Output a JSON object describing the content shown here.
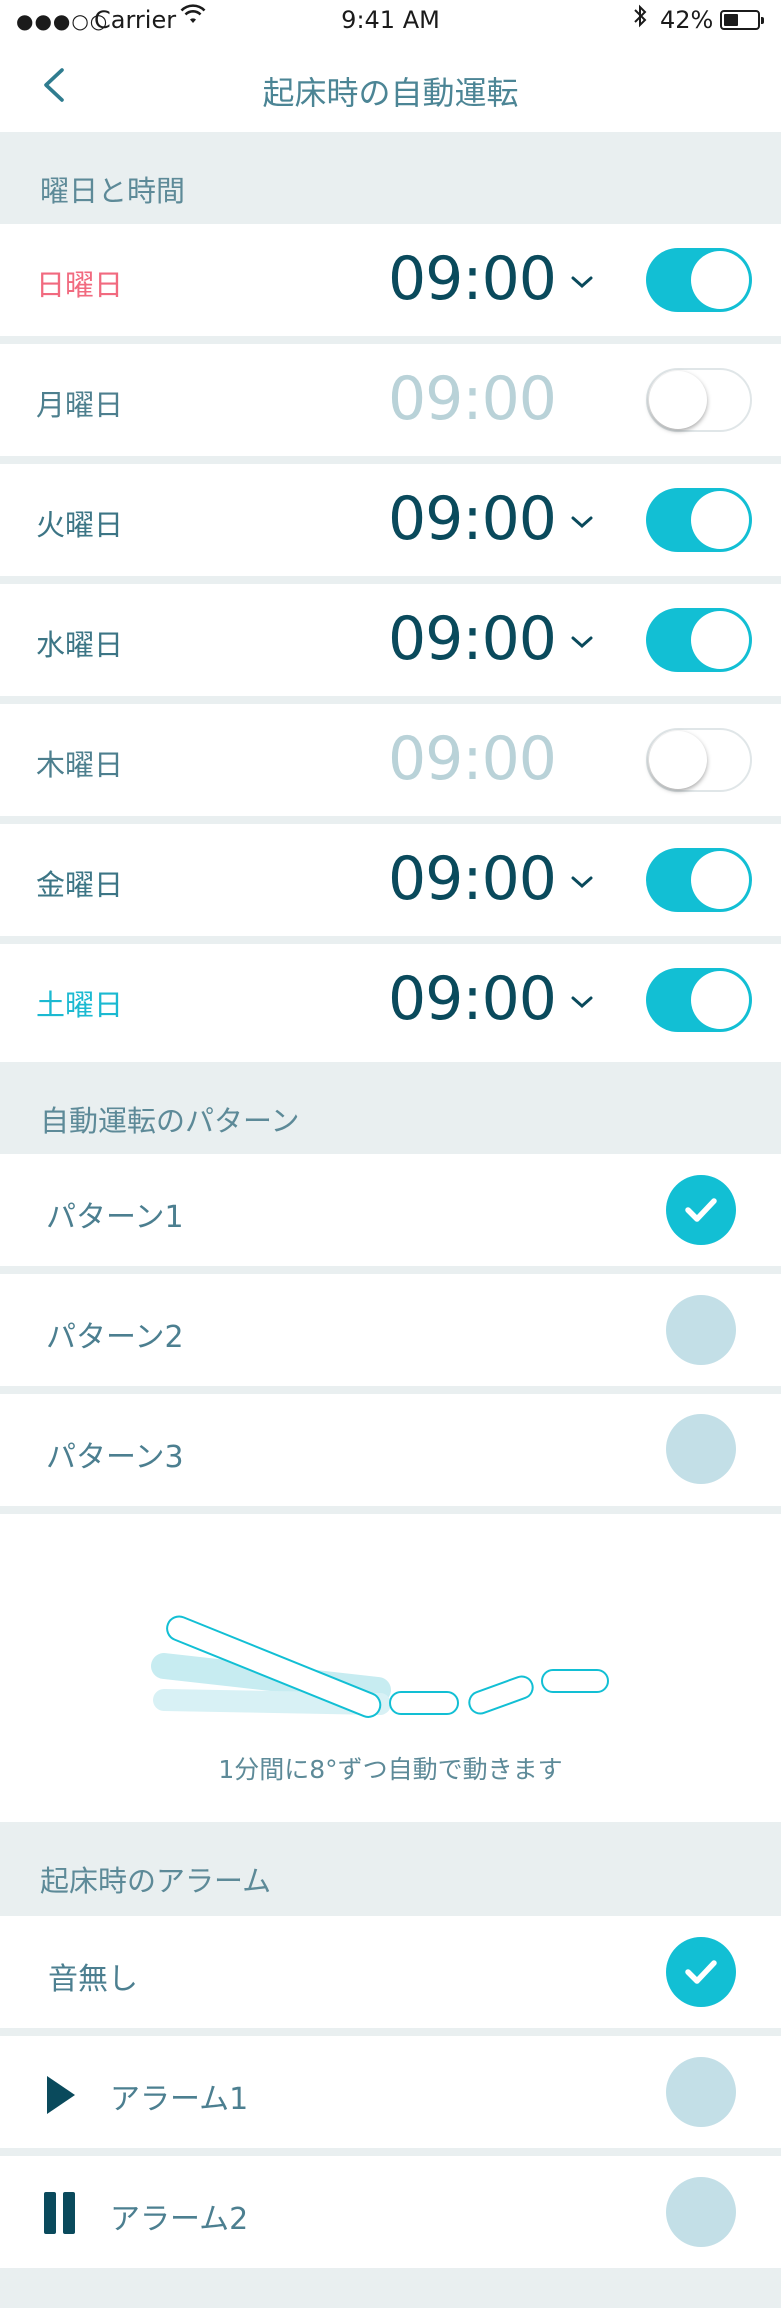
{
  "status_bar": {
    "signal": "●●●○○",
    "carrier": "Carrier",
    "time": "9:41 AM",
    "bluetooth_icon": "bluetooth-icon",
    "battery_pct": "42%"
  },
  "nav": {
    "title": "起床時の自動運転",
    "back_icon": "chevron-left-icon"
  },
  "schedule": {
    "header": "曜日と時間",
    "days": [
      {
        "label": "日曜日",
        "time": "09:00",
        "enabled": true
      },
      {
        "label": "月曜日",
        "time": "09:00",
        "enabled": false
      },
      {
        "label": "火曜日",
        "time": "09:00",
        "enabled": true
      },
      {
        "label": "水曜日",
        "time": "09:00",
        "enabled": true
      },
      {
        "label": "木曜日",
        "time": "09:00",
        "enabled": false
      },
      {
        "label": "金曜日",
        "time": "09:00",
        "enabled": true
      },
      {
        "label": "土曜日",
        "time": "09:00",
        "enabled": true
      }
    ]
  },
  "patterns": {
    "header": "自動運転のパターン",
    "options": [
      {
        "label": "パターン1",
        "selected": true
      },
      {
        "label": "パターン2",
        "selected": false
      },
      {
        "label": "パターン3",
        "selected": false
      }
    ],
    "caption": "1分間に8°ずつ自動で動きます"
  },
  "alarm": {
    "header": "起床時のアラーム",
    "options": [
      {
        "label": "音無し",
        "selected": true,
        "icon": ""
      },
      {
        "label": "アラーム1",
        "selected": false,
        "icon": "play-icon"
      },
      {
        "label": "アラーム2",
        "selected": false,
        "icon": "pause-icon"
      }
    ]
  },
  "colors": {
    "accent": "#12bfd4",
    "sunday": "#f16a7f",
    "saturday": "#1bb9d1",
    "time_dark": "#0a4a5c",
    "disabled": "#b9d2d8"
  }
}
